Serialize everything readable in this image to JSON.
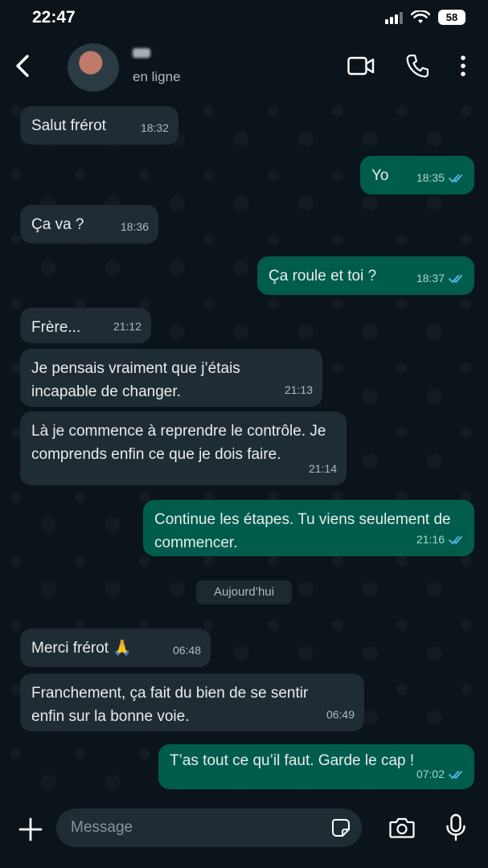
{
  "status_bar": {
    "time": "22:47",
    "battery": "58"
  },
  "header": {
    "status": "en ligne"
  },
  "messages": [
    {
      "text": "Salut frérot",
      "time": "18:32"
    },
    {
      "text": "Yo",
      "time": "18:35"
    },
    {
      "text": "Ça va ?",
      "time": "18:36"
    },
    {
      "text": "Ça roule et toi ?",
      "time": "18:37"
    },
    {
      "text": "Frère...",
      "time": "21:12"
    },
    {
      "text": "Je pensais vraiment que j’étais incapable de changer.",
      "time": "21:13"
    },
    {
      "text": "Là je commence à reprendre le contrôle. Je comprends enfin ce que je dois faire.",
      "time": "21:14"
    },
    {
      "text": "Continue les étapes. Tu viens seulement de commencer.",
      "time": "21:16"
    },
    {
      "text": "Merci frérot 🙏",
      "time": "06:48"
    },
    {
      "text": "Franchement, ça fait du bien de se sentir enfin sur la bonne voie.",
      "time": "06:49"
    },
    {
      "text": "T’as tout ce qu’il faut. Garde le cap !",
      "time": "07:02"
    }
  ],
  "day_separator": "Aujourd’hui",
  "composer": {
    "placeholder": "Message"
  },
  "colors": {
    "background": "#0b141a",
    "incoming": "#202c33",
    "outgoing": "#005c4b",
    "read_ticks": "#53bdeb"
  }
}
